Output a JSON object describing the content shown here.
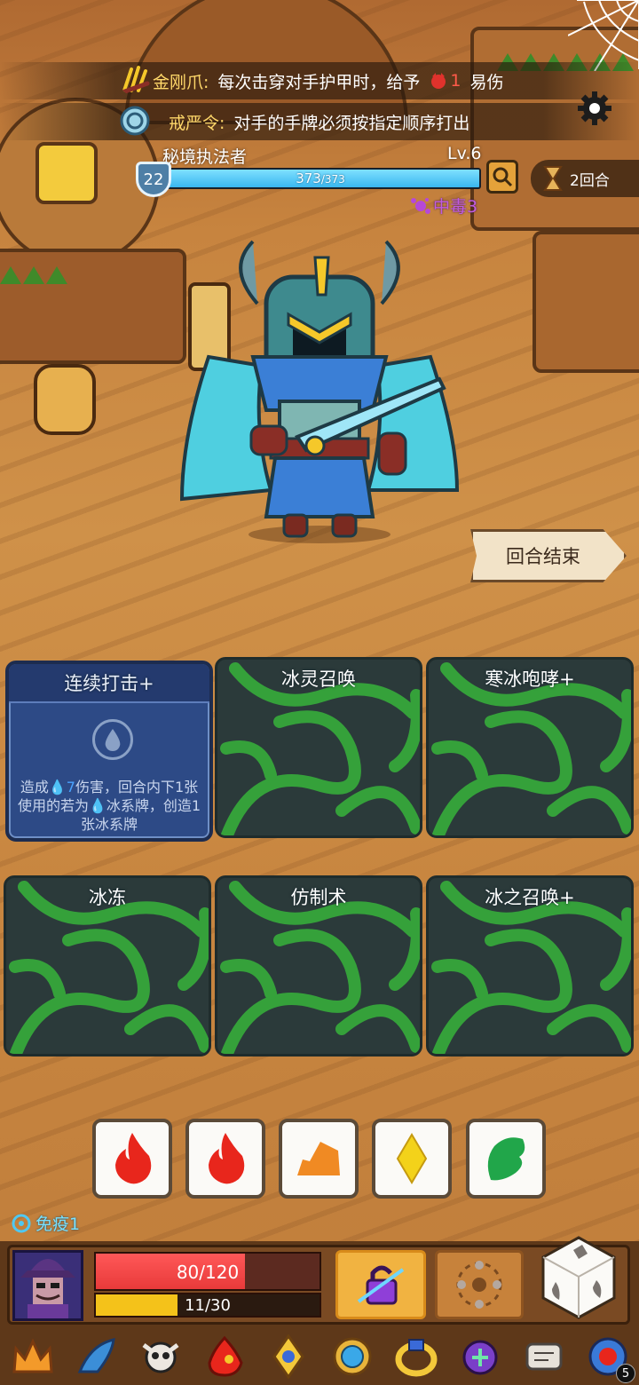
{
  "passives": [
    {
      "name": "金刚爪:",
      "text_before": "每次击穿对手护甲时，给予",
      "count": "1",
      "text_after": "易伤",
      "icon": "claw-icon"
    },
    {
      "name": "戒严令:",
      "text": "对手的手牌必须按指定顺序打出",
      "icon": "seal-icon"
    }
  ],
  "enemy": {
    "name": "秘境执法者",
    "level": "Lv.6",
    "hp_text": "373",
    "hp_max_text": "/373",
    "hp_fraction": 1.0,
    "armor": "22",
    "status": "中毒3"
  },
  "turn": {
    "label": "2回合"
  },
  "end_turn_button": "回合结束",
  "cards": [
    {
      "title": "连续打击+",
      "face": "up",
      "desc_a": "造成",
      "desc_dmg": "7",
      "desc_b": "伤害，回合内下1张使用的若为",
      "desc_c": "冰系牌，创造1张冰系牌"
    },
    {
      "title": "冰灵召唤",
      "face": "down"
    },
    {
      "title": "寒冰咆哮+",
      "face": "down"
    },
    {
      "title": "冰冻",
      "face": "down"
    },
    {
      "title": "仿制术",
      "face": "down"
    },
    {
      "title": "冰之召唤+",
      "face": "down"
    }
  ],
  "dice": [
    {
      "symbol": "fire-icon",
      "color": "#e8261c"
    },
    {
      "symbol": "fire-icon",
      "color": "#e8261c"
    },
    {
      "symbol": "earth-icon",
      "color": "#f08a23"
    },
    {
      "symbol": "diamond-icon",
      "color": "#f3d21a"
    },
    {
      "symbol": "leaf-icon",
      "color": "#21a64a"
    }
  ],
  "player": {
    "immune": "免疫1",
    "hp_text": "80/120",
    "hp_fraction": 0.667,
    "energy_text": "11/30",
    "energy_fraction": 0.367
  },
  "relics": [
    {
      "icon": "crown-icon"
    },
    {
      "icon": "horn-icon"
    },
    {
      "icon": "skull-icon"
    },
    {
      "icon": "red-flame-icon"
    },
    {
      "icon": "eye-amulet-icon"
    },
    {
      "icon": "blue-gem-ring-icon"
    },
    {
      "icon": "gold-ring-icon"
    },
    {
      "icon": "purple-amulet-icon"
    },
    {
      "icon": "scroll-icon"
    },
    {
      "icon": "orb-icon",
      "badge": "5"
    }
  ]
}
